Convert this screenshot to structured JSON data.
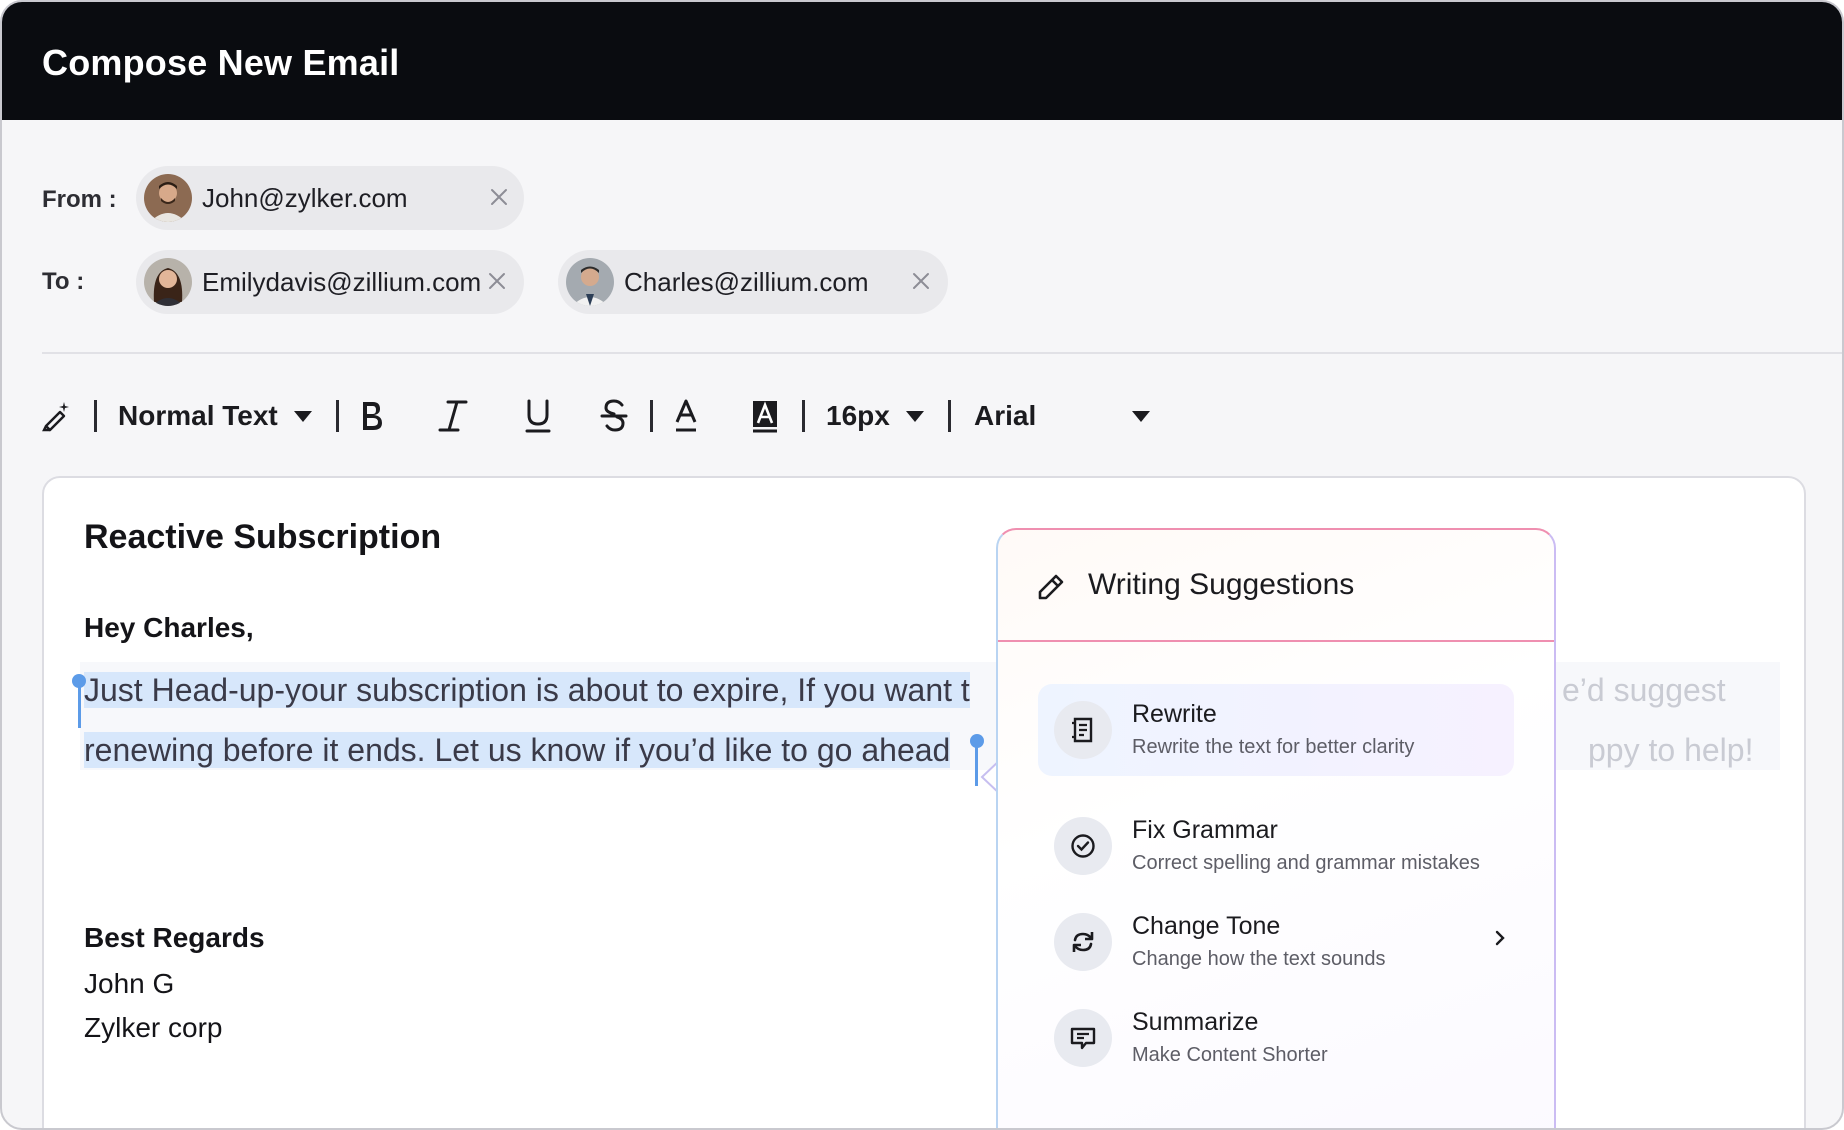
{
  "window": {
    "title": "Compose New Email"
  },
  "from": {
    "label": "From :",
    "chips": [
      {
        "address": "John@zylker.com"
      }
    ]
  },
  "to": {
    "label": "To :",
    "chips": [
      {
        "address": "Emilydavis@zillium.com"
      },
      {
        "address": "Charles@zillium.com"
      }
    ]
  },
  "toolbar": {
    "text_style": "Normal Text",
    "font_size": "16px",
    "font_family": "Arial",
    "icons": [
      "magic-wand-icon",
      "bold-icon",
      "italic-icon",
      "underline-icon",
      "strikethrough-icon",
      "text-color-icon",
      "highlight-icon"
    ]
  },
  "editor": {
    "subject": "Reactive Subscription",
    "greeting": "Hey Charles,",
    "line1_selected": "Just Head-up-your subscription is about to expire, If you want t",
    "line1_faded": "e’d suggest",
    "line2_selected": "renewing before it ends. Let us know if you’d like to go ahead",
    "line2_faded": "ppy to help!",
    "signoff": "Best Regards",
    "name": "John G",
    "company": "Zylker corp"
  },
  "suggestions": {
    "title": "Writing Suggestions",
    "items": [
      {
        "title": "Rewrite",
        "desc": "Rewrite the text for better clarity"
      },
      {
        "title": "Fix Grammar",
        "desc": "Correct spelling and grammar mistakes"
      },
      {
        "title": "Change Tone",
        "desc": "Change how the text sounds"
      },
      {
        "title": "Summarize",
        "desc": "Make Content Shorter"
      }
    ]
  },
  "colors": {
    "titlebar": "#0a0c10",
    "selection": "#d7e7fb",
    "cursor": "#5c9be8",
    "panel_border": "#ef8fb0"
  }
}
